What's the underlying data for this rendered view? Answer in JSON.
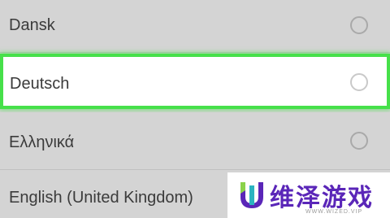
{
  "languages": [
    {
      "label": "Dansk",
      "selected": false
    },
    {
      "label": "Deutsch",
      "selected": false,
      "highlighted": true
    },
    {
      "label": "Ελληνικά",
      "selected": false
    },
    {
      "label": "English (United Kingdom)",
      "selected": false
    }
  ],
  "colors": {
    "background": "#d4d4d4",
    "highlight_border": "#46e04a",
    "radio_border": "#a9a9a9",
    "watermark_text": "#5a26b8"
  },
  "watermark": {
    "title": "维泽游戏",
    "subtitle": "WWW.WIZED.VIP",
    "logo_icon": "wized-logo"
  }
}
